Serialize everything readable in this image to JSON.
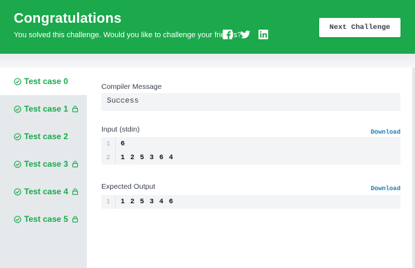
{
  "banner": {
    "title": "Congratulations",
    "subtitle": "You solved this challenge. Would you like to challenge your friends?",
    "social_icons": [
      "facebook-icon",
      "twitter-icon",
      "linkedin-icon"
    ],
    "next_button": "Next Challenge",
    "bg_color": "#1ba94c"
  },
  "tabs": [
    {
      "label": "Test case 0",
      "locked": false,
      "active": true
    },
    {
      "label": "Test case 1",
      "locked": true,
      "active": false
    },
    {
      "label": "Test case 2",
      "locked": false,
      "active": false
    },
    {
      "label": "Test case 3",
      "locked": true,
      "active": false
    },
    {
      "label": "Test case 4",
      "locked": true,
      "active": false
    },
    {
      "label": "Test case 5",
      "locked": true,
      "active": false
    }
  ],
  "compiler": {
    "label": "Compiler Message",
    "message": "Success"
  },
  "input": {
    "label": "Input (stdin)",
    "download": "Download",
    "lines": [
      {
        "num": "1",
        "text": "6"
      },
      {
        "num": "2",
        "text": "1 2 5 3 6 4"
      }
    ]
  },
  "expected": {
    "label": "Expected Output",
    "download": "Download",
    "lines": [
      {
        "num": "1",
        "text": "1 2 5 3 4 6"
      }
    ]
  }
}
